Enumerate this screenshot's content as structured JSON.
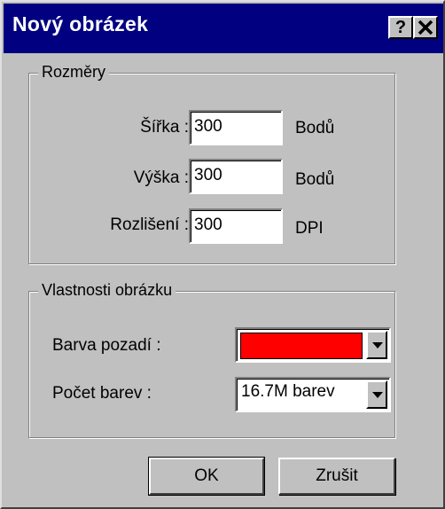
{
  "window": {
    "title": "Nový obrázek",
    "help_label": "?",
    "close_label": "✕"
  },
  "dimensions": {
    "legend": "Rozměry",
    "width_label": "Šířka :",
    "width_value": "300",
    "width_unit": "Bodů",
    "height_label": "Výška :",
    "height_value": "300",
    "height_unit": "Bodů",
    "resolution_label": "Rozlišení :",
    "resolution_value": "300",
    "resolution_unit": "DPI"
  },
  "properties": {
    "legend": "Vlastnosti obrázku",
    "bgcolor_label": "Barva pozadí :",
    "bgcolor_value": "#ff0000",
    "colors_label": "Počet barev :",
    "colors_value": "16.7M barev"
  },
  "buttons": {
    "ok_label": "OK",
    "cancel_label": "Zrušit"
  },
  "colors": {
    "titlebar": "#000080",
    "face": "#c0c0c0"
  }
}
